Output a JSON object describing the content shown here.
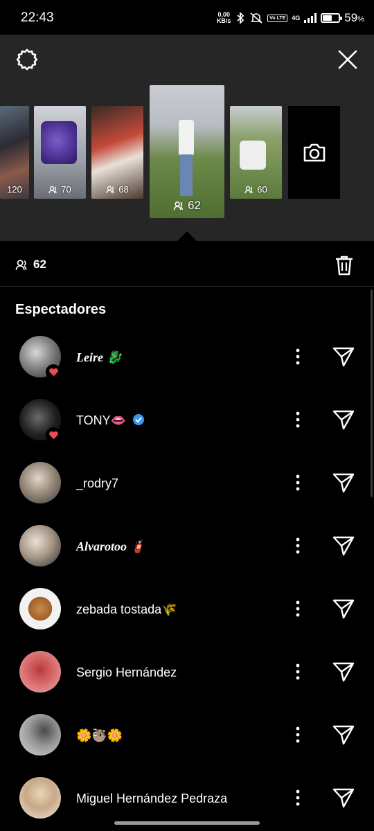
{
  "status_bar": {
    "time": "22:43",
    "net_speed_value": "0,00",
    "net_speed_unit": "KB/s",
    "volte": "Vo LTE",
    "network": "4G",
    "battery_percent": 59,
    "battery_label": "59"
  },
  "top": {
    "settings_icon": "gear-icon",
    "close_icon": "close-icon"
  },
  "stories": [
    {
      "views": "120"
    },
    {
      "views": "70"
    },
    {
      "views": "68"
    },
    {
      "views": "62",
      "selected": true
    },
    {
      "views": "60"
    }
  ],
  "camera_icon": "camera-icon",
  "summary": {
    "view_count": "62",
    "delete_icon": "trash-icon"
  },
  "section_title": "Espectadores",
  "viewers": [
    {
      "name": "Leire 🐉",
      "liked": true,
      "verified": false,
      "serif": true
    },
    {
      "name": "TONY👄",
      "liked": true,
      "verified": true,
      "serif": false
    },
    {
      "name": "_rodry7",
      "liked": false,
      "verified": false,
      "serif": false
    },
    {
      "name": "Alvarotoo 🧯",
      "liked": false,
      "verified": false,
      "serif": true
    },
    {
      "name": "zebada tostada🌾",
      "liked": false,
      "verified": false,
      "serif": false
    },
    {
      "name": "Sergio Hernández",
      "liked": false,
      "verified": false,
      "serif": false
    },
    {
      "name": "🌼🦥🌼",
      "liked": false,
      "verified": false,
      "serif": false
    },
    {
      "name": "Miguel Hernández Pedraza",
      "liked": false,
      "verified": false,
      "serif": false
    }
  ],
  "colors": {
    "panel_bg": "#262626",
    "background": "#000000",
    "heart": "#ed4956",
    "verified": "#3897f0"
  }
}
